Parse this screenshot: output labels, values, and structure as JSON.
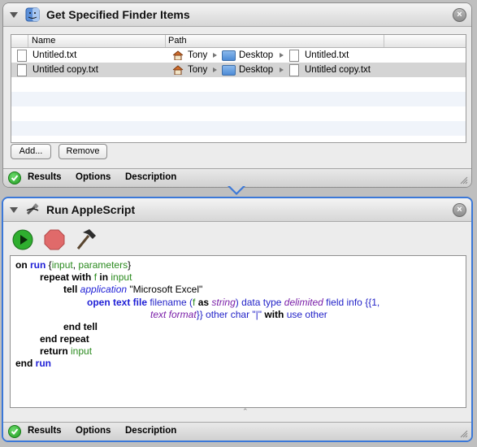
{
  "action1": {
    "title": "Get Specified Finder Items",
    "columns": {
      "name": "Name",
      "path": "Path"
    },
    "rows": [
      {
        "name": "Untitled.txt",
        "home": "Tony",
        "folder": "Desktop",
        "file": "Untitled.txt"
      },
      {
        "name": "Untitled copy.txt",
        "home": "Tony",
        "folder": "Desktop",
        "file": "Untitled copy.txt"
      }
    ],
    "add_label": "Add...",
    "remove_label": "Remove",
    "footer": {
      "results": "Results",
      "options": "Options",
      "description": "Description"
    }
  },
  "action2": {
    "title": "Run AppleScript",
    "script": {
      "l1": {
        "a": "on ",
        "b": "run",
        "c": " {",
        "d": "input",
        "e": ", ",
        "f": "parameters",
        "g": "}"
      },
      "l2": {
        "a": "repeat with ",
        "b": "f",
        "c": " in ",
        "d": "input"
      },
      "l3": {
        "a": "tell ",
        "b": "application",
        "c": " \"Microsoft Excel\""
      },
      "l4": {
        "a": "open text file",
        "b": " filename (",
        "c": "f",
        "d": " as ",
        "e": "string",
        "f": ") data type ",
        "g": "delimited",
        "h": " field info {{1,"
      },
      "l5": {
        "a": "text format",
        "b": "}} other char \"|\" ",
        "c": "with",
        "d": " use other"
      },
      "l6": {
        "a": "end tell"
      },
      "l7": {
        "a": "end repeat"
      },
      "l8": {
        "a": "return ",
        "b": "input"
      },
      "l9": {
        "a": "end ",
        "b": "run"
      }
    },
    "footer": {
      "results": "Results",
      "options": "Options",
      "description": "Description"
    }
  },
  "colors": {
    "selection_border": "#3b78d8",
    "keyword_blue": "#1f1fd6",
    "variable_green": "#2a8a1e",
    "class_purple": "#7a1fa8"
  }
}
